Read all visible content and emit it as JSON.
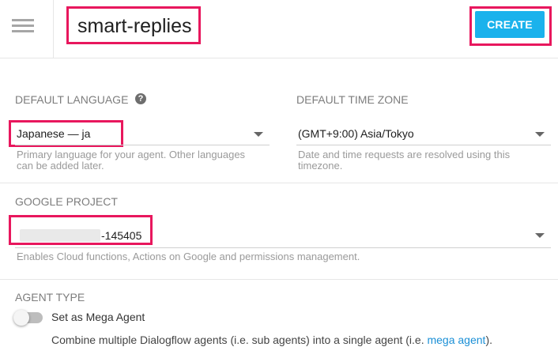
{
  "header": {
    "agent_name": "smart-replies",
    "create_label": "CREATE"
  },
  "default_language": {
    "label": "DEFAULT LANGUAGE",
    "help_icon": "?",
    "value": "Japanese — ja",
    "hint": "Primary language for your agent. Other languages can be added later."
  },
  "time_zone": {
    "label": "DEFAULT TIME ZONE",
    "value": "(GMT+9:00) Asia/Tokyo",
    "hint": "Date and time requests are resolved using this timezone."
  },
  "google_project": {
    "label": "GOOGLE PROJECT",
    "value_suffix": "-145405",
    "hint": "Enables Cloud functions, Actions on Google and permissions management."
  },
  "agent_type": {
    "label": "AGENT TYPE",
    "toggle_label": "Set as Mega Agent",
    "toggle_on": false,
    "desc_before": "Combine multiple Dialogflow agents (i.e. sub agents) into a single agent (i.e. ",
    "desc_link": "mega agent",
    "desc_after": ")."
  }
}
